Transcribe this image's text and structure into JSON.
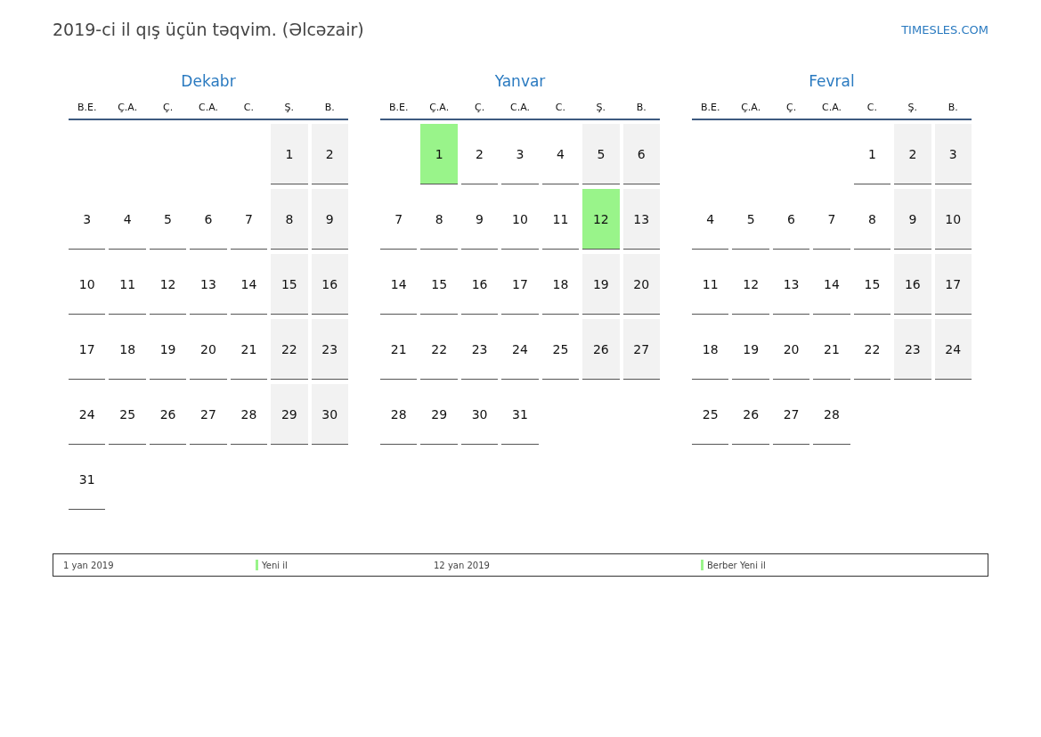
{
  "title": "2019-ci il qış üçün təqvim. (Əlcəzair)",
  "site": "TIMESLES.COM",
  "months": [
    {
      "name": "Dekabr",
      "weekdays": [
        {
          "label": "B.E.",
          "weekend": false
        },
        {
          "label": "Ç.A.",
          "weekend": false
        },
        {
          "label": "Ç.",
          "weekend": false
        },
        {
          "label": "C.A.",
          "weekend": false
        },
        {
          "label": "C.",
          "weekend": false
        },
        {
          "label": "Ş.",
          "weekend": true
        },
        {
          "label": "B.",
          "weekend": true
        }
      ],
      "weeks": [
        [
          {
            "kind": "blank"
          },
          {
            "kind": "blank"
          },
          {
            "kind": "blank"
          },
          {
            "kind": "blank"
          },
          {
            "kind": "blank"
          },
          {
            "kind": "day",
            "day": "1",
            "holiday": false
          },
          {
            "kind": "day",
            "day": "2",
            "holiday": false
          }
        ],
        [
          {
            "kind": "day",
            "day": "3",
            "holiday": false
          },
          {
            "kind": "day",
            "day": "4",
            "holiday": false
          },
          {
            "kind": "day",
            "day": "5",
            "holiday": false
          },
          {
            "kind": "day",
            "day": "6",
            "holiday": false
          },
          {
            "kind": "day",
            "day": "7",
            "holiday": false
          },
          {
            "kind": "day",
            "day": "8",
            "holiday": false
          },
          {
            "kind": "day",
            "day": "9",
            "holiday": false
          }
        ],
        [
          {
            "kind": "day",
            "day": "10",
            "holiday": false
          },
          {
            "kind": "day",
            "day": "11",
            "holiday": false
          },
          {
            "kind": "day",
            "day": "12",
            "holiday": false
          },
          {
            "kind": "day",
            "day": "13",
            "holiday": false
          },
          {
            "kind": "day",
            "day": "14",
            "holiday": false
          },
          {
            "kind": "day",
            "day": "15",
            "holiday": false
          },
          {
            "kind": "day",
            "day": "16",
            "holiday": false
          }
        ],
        [
          {
            "kind": "day",
            "day": "17",
            "holiday": false
          },
          {
            "kind": "day",
            "day": "18",
            "holiday": false
          },
          {
            "kind": "day",
            "day": "19",
            "holiday": false
          },
          {
            "kind": "day",
            "day": "20",
            "holiday": false
          },
          {
            "kind": "day",
            "day": "21",
            "holiday": false
          },
          {
            "kind": "day",
            "day": "22",
            "holiday": false
          },
          {
            "kind": "day",
            "day": "23",
            "holiday": false
          }
        ],
        [
          {
            "kind": "day",
            "day": "24",
            "holiday": false
          },
          {
            "kind": "day",
            "day": "25",
            "holiday": false
          },
          {
            "kind": "day",
            "day": "26",
            "holiday": false
          },
          {
            "kind": "day",
            "day": "27",
            "holiday": false
          },
          {
            "kind": "day",
            "day": "28",
            "holiday": false
          },
          {
            "kind": "day",
            "day": "29",
            "holiday": false
          },
          {
            "kind": "day",
            "day": "30",
            "holiday": false
          }
        ],
        [
          {
            "kind": "day",
            "day": "31",
            "holiday": false
          }
        ]
      ]
    },
    {
      "name": "Yanvar",
      "weekdays": [
        {
          "label": "B.E.",
          "weekend": false
        },
        {
          "label": "Ç.A.",
          "weekend": false
        },
        {
          "label": "Ç.",
          "weekend": false
        },
        {
          "label": "C.A.",
          "weekend": false
        },
        {
          "label": "C.",
          "weekend": false
        },
        {
          "label": "Ş.",
          "weekend": true
        },
        {
          "label": "B.",
          "weekend": true
        }
      ],
      "weeks": [
        [
          {
            "kind": "blank"
          },
          {
            "kind": "day",
            "day": "1",
            "holiday": true
          },
          {
            "kind": "day",
            "day": "2",
            "holiday": false
          },
          {
            "kind": "day",
            "day": "3",
            "holiday": false
          },
          {
            "kind": "day",
            "day": "4",
            "holiday": false
          },
          {
            "kind": "day",
            "day": "5",
            "holiday": false
          },
          {
            "kind": "day",
            "day": "6",
            "holiday": false
          }
        ],
        [
          {
            "kind": "day",
            "day": "7",
            "holiday": false
          },
          {
            "kind": "day",
            "day": "8",
            "holiday": false
          },
          {
            "kind": "day",
            "day": "9",
            "holiday": false
          },
          {
            "kind": "day",
            "day": "10",
            "holiday": false
          },
          {
            "kind": "day",
            "day": "11",
            "holiday": false
          },
          {
            "kind": "day",
            "day": "12",
            "holiday": true
          },
          {
            "kind": "day",
            "day": "13",
            "holiday": false
          }
        ],
        [
          {
            "kind": "day",
            "day": "14",
            "holiday": false
          },
          {
            "kind": "day",
            "day": "15",
            "holiday": false
          },
          {
            "kind": "day",
            "day": "16",
            "holiday": false
          },
          {
            "kind": "day",
            "day": "17",
            "holiday": false
          },
          {
            "kind": "day",
            "day": "18",
            "holiday": false
          },
          {
            "kind": "day",
            "day": "19",
            "holiday": false
          },
          {
            "kind": "day",
            "day": "20",
            "holiday": false
          }
        ],
        [
          {
            "kind": "day",
            "day": "21",
            "holiday": false
          },
          {
            "kind": "day",
            "day": "22",
            "holiday": false
          },
          {
            "kind": "day",
            "day": "23",
            "holiday": false
          },
          {
            "kind": "day",
            "day": "24",
            "holiday": false
          },
          {
            "kind": "day",
            "day": "25",
            "holiday": false
          },
          {
            "kind": "day",
            "day": "26",
            "holiday": false
          },
          {
            "kind": "day",
            "day": "27",
            "holiday": false
          }
        ],
        [
          {
            "kind": "day",
            "day": "28",
            "holiday": false
          },
          {
            "kind": "day",
            "day": "29",
            "holiday": false
          },
          {
            "kind": "day",
            "day": "30",
            "holiday": false
          },
          {
            "kind": "day",
            "day": "31",
            "holiday": false
          }
        ]
      ]
    },
    {
      "name": "Fevral",
      "weekdays": [
        {
          "label": "B.E.",
          "weekend": false
        },
        {
          "label": "Ç.A.",
          "weekend": false
        },
        {
          "label": "Ç.",
          "weekend": false
        },
        {
          "label": "C.A.",
          "weekend": false
        },
        {
          "label": "C.",
          "weekend": false
        },
        {
          "label": "Ş.",
          "weekend": true
        },
        {
          "label": "B.",
          "weekend": true
        }
      ],
      "weeks": [
        [
          {
            "kind": "blank"
          },
          {
            "kind": "blank"
          },
          {
            "kind": "blank"
          },
          {
            "kind": "blank"
          },
          {
            "kind": "day",
            "day": "1",
            "holiday": false
          },
          {
            "kind": "day",
            "day": "2",
            "holiday": false
          },
          {
            "kind": "day",
            "day": "3",
            "holiday": false
          }
        ],
        [
          {
            "kind": "day",
            "day": "4",
            "holiday": false
          },
          {
            "kind": "day",
            "day": "5",
            "holiday": false
          },
          {
            "kind": "day",
            "day": "6",
            "holiday": false
          },
          {
            "kind": "day",
            "day": "7",
            "holiday": false
          },
          {
            "kind": "day",
            "day": "8",
            "holiday": false
          },
          {
            "kind": "day",
            "day": "9",
            "holiday": false
          },
          {
            "kind": "day",
            "day": "10",
            "holiday": false
          }
        ],
        [
          {
            "kind": "day",
            "day": "11",
            "holiday": false
          },
          {
            "kind": "day",
            "day": "12",
            "holiday": false
          },
          {
            "kind": "day",
            "day": "13",
            "holiday": false
          },
          {
            "kind": "day",
            "day": "14",
            "holiday": false
          },
          {
            "kind": "day",
            "day": "15",
            "holiday": false
          },
          {
            "kind": "day",
            "day": "16",
            "holiday": false
          },
          {
            "kind": "day",
            "day": "17",
            "holiday": false
          }
        ],
        [
          {
            "kind": "day",
            "day": "18",
            "holiday": false
          },
          {
            "kind": "day",
            "day": "19",
            "holiday": false
          },
          {
            "kind": "day",
            "day": "20",
            "holiday": false
          },
          {
            "kind": "day",
            "day": "21",
            "holiday": false
          },
          {
            "kind": "day",
            "day": "22",
            "holiday": false
          },
          {
            "kind": "day",
            "day": "23",
            "holiday": false
          },
          {
            "kind": "day",
            "day": "24",
            "holiday": false
          }
        ],
        [
          {
            "kind": "day",
            "day": "25",
            "holiday": false
          },
          {
            "kind": "day",
            "day": "26",
            "holiday": false
          },
          {
            "kind": "day",
            "day": "27",
            "holiday": false
          },
          {
            "kind": "day",
            "day": "28",
            "holiday": false
          }
        ]
      ]
    }
  ],
  "legend": [
    {
      "date": "1 yan 2019",
      "name": "Yeni il",
      "color": "#99f48a"
    },
    {
      "date": "12 yan 2019",
      "name": "Berber Yeni il",
      "color": "#99f48a"
    }
  ]
}
